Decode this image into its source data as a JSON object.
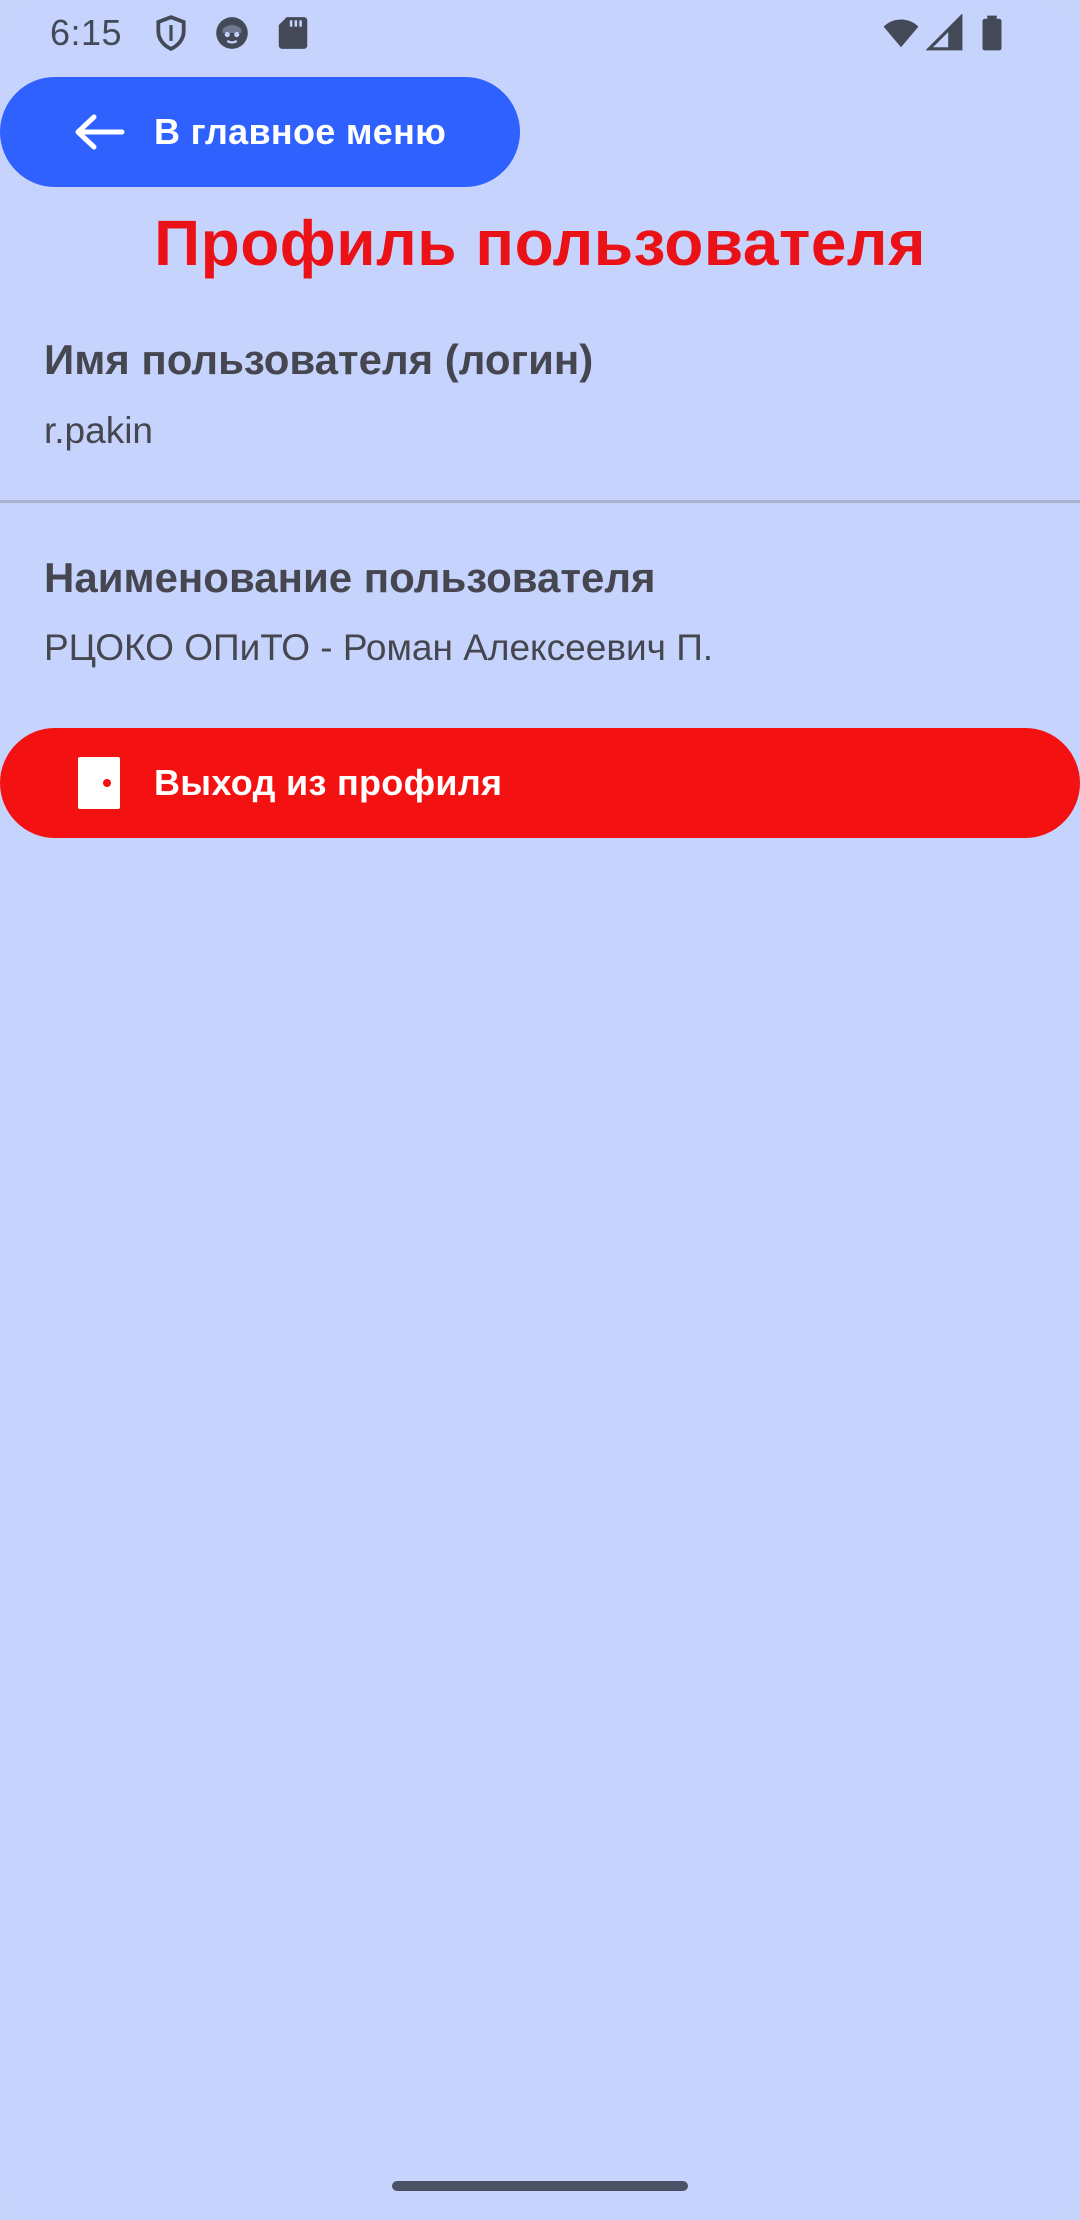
{
  "status_bar": {
    "time": "6:15",
    "icons": [
      "shield-icon",
      "face-icon",
      "sd-card-icon",
      "wifi-icon",
      "signal-icon",
      "battery-icon"
    ]
  },
  "header": {
    "back_label": "В главное меню",
    "back_icon": "arrow-left-icon",
    "title": "Профиль пользователя"
  },
  "profile": {
    "login_label": "Имя пользователя (логин)",
    "login_value": "r.pakin",
    "name_label": "Наименование пользователя",
    "name_value": "РЦОКО ОПиТО - Роман Алексеевич П."
  },
  "logout": {
    "label": "Выход из профиля",
    "icon": "door-icon"
  },
  "colors": {
    "background": "#c6d4fd",
    "primary_button": "#2f61ff",
    "logout_button": "#f41111",
    "title": "#ea1216",
    "text": "#45464f"
  }
}
